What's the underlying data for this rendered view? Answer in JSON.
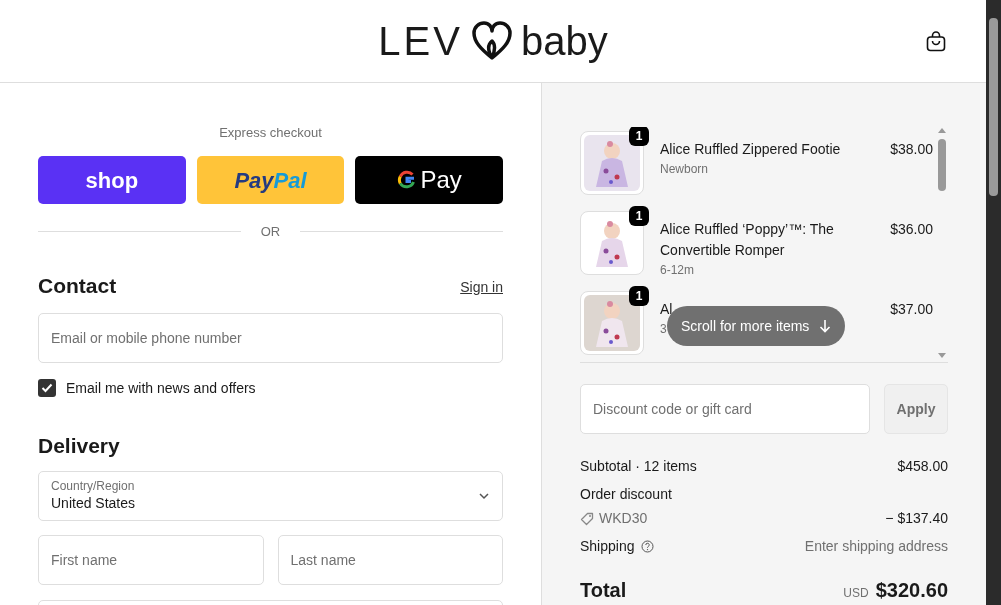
{
  "header": {
    "logo_left": "LEV",
    "logo_right": "baby"
  },
  "express_checkout": {
    "title": "Express checkout",
    "buttons": [
      {
        "kind": "shop",
        "label": "shop"
      },
      {
        "kind": "paypal",
        "parts": [
          "Pay",
          "Pal"
        ]
      },
      {
        "kind": "gpay",
        "label": "Pay"
      }
    ],
    "divider": "OR"
  },
  "contact": {
    "heading": "Contact",
    "sign_in": "Sign in",
    "email_placeholder": "Email or mobile phone number",
    "newsletter": {
      "label": "Email me with news and offers",
      "checked": true
    }
  },
  "delivery": {
    "heading": "Delivery",
    "country": {
      "label": "Country/Region",
      "value": "United States"
    },
    "first_name_placeholder": "First name",
    "last_name_placeholder": "Last name"
  },
  "order_items": [
    {
      "quantity": "1",
      "name": "Alice Ruffled Zippered Footie",
      "variant": "Newborn",
      "price": "$38.00"
    },
    {
      "quantity": "1",
      "name": "Alice Ruffled ‘Poppy’™: The Convertible Romper",
      "variant": "6-12m",
      "price": "$36.00"
    },
    {
      "quantity": "1",
      "name": "Al",
      "variant": "3",
      "price": "$37.00"
    }
  ],
  "scroll_hint": "Scroll for more items",
  "discount": {
    "placeholder": "Discount code or gift card",
    "button": "Apply"
  },
  "summary": {
    "subtotal_label": "Subtotal · 12 items",
    "subtotal": "$458.00",
    "order_discount_label": "Order discount",
    "code": "WKD30",
    "discount_amount": "− $137.40",
    "shipping_label": "Shipping",
    "shipping_value": "Enter shipping address",
    "total_label": "Total",
    "currency": "USD",
    "total": "$320.60"
  }
}
